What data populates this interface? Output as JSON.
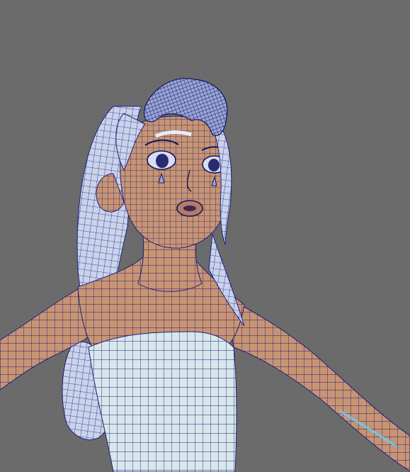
{
  "viewport": {
    "background": "#6b6b6b",
    "subject": "wireframe-character-model",
    "colors": {
      "skin": "#c89472",
      "skin_shadow": "#a97a5c",
      "hair": "#c9d3ea",
      "hair_shadow": "#a6b2d6",
      "cloth": "#d7e7ea",
      "wire": "#1f1f7a",
      "wire_dense": "#14145c",
      "selection": "#5fd0ff"
    }
  }
}
